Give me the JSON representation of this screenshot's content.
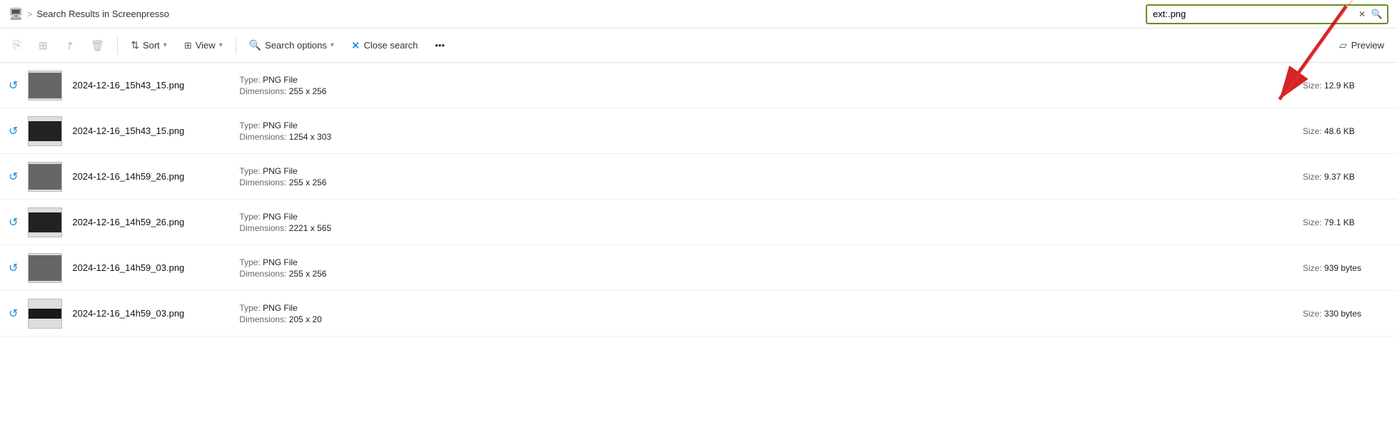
{
  "titlebar": {
    "monitor_icon": "🖥",
    "chevron": ">",
    "path": "Search Results in Screenpresso",
    "search_value": "ext:.png",
    "clear_btn": "✕",
    "search_btn": "🔍"
  },
  "toolbar": {
    "copy_icon": "📋",
    "copy_label": "",
    "gallery_icon": "⊞",
    "gallery_label": "",
    "share_icon": "↗",
    "share_label": "",
    "delete_icon": "🗑",
    "delete_label": "",
    "sort_icon": "↑↓",
    "sort_label": "Sort",
    "view_icon": "⊞",
    "view_label": "View",
    "searchopts_label": "Search options",
    "closesearch_label": "Close search",
    "more_label": "•••",
    "preview_label": "Preview"
  },
  "files": [
    {
      "name": "2024-12-16_15h43_15.png",
      "type": "PNG File",
      "dimensions": "255 x 256",
      "size": "12.9 KB",
      "thumb_style": "small"
    },
    {
      "name": "2024-12-16_15h43_15.png",
      "type": "PNG File",
      "dimensions": "1254 x 303",
      "size": "48.6 KB",
      "thumb_style": "wide"
    },
    {
      "name": "2024-12-16_14h59_26.png",
      "type": "PNG File",
      "dimensions": "255 x 256",
      "size": "9.37 KB",
      "thumb_style": "small"
    },
    {
      "name": "2024-12-16_14h59_26.png",
      "type": "PNG File",
      "dimensions": "2221 x 565",
      "size": "79.1 KB",
      "thumb_style": "wide"
    },
    {
      "name": "2024-12-16_14h59_03.png",
      "type": "PNG File",
      "dimensions": "255 x 256",
      "size": "939 bytes",
      "thumb_style": "small"
    },
    {
      "name": "2024-12-16_14h59_03.png",
      "type": "PNG File",
      "dimensions": "205 x 20",
      "size": "330 bytes",
      "thumb_style": "tiny"
    }
  ],
  "labels": {
    "type_prefix": "Type: ",
    "dims_prefix": "Dimensions: ",
    "size_prefix": "Size: "
  }
}
